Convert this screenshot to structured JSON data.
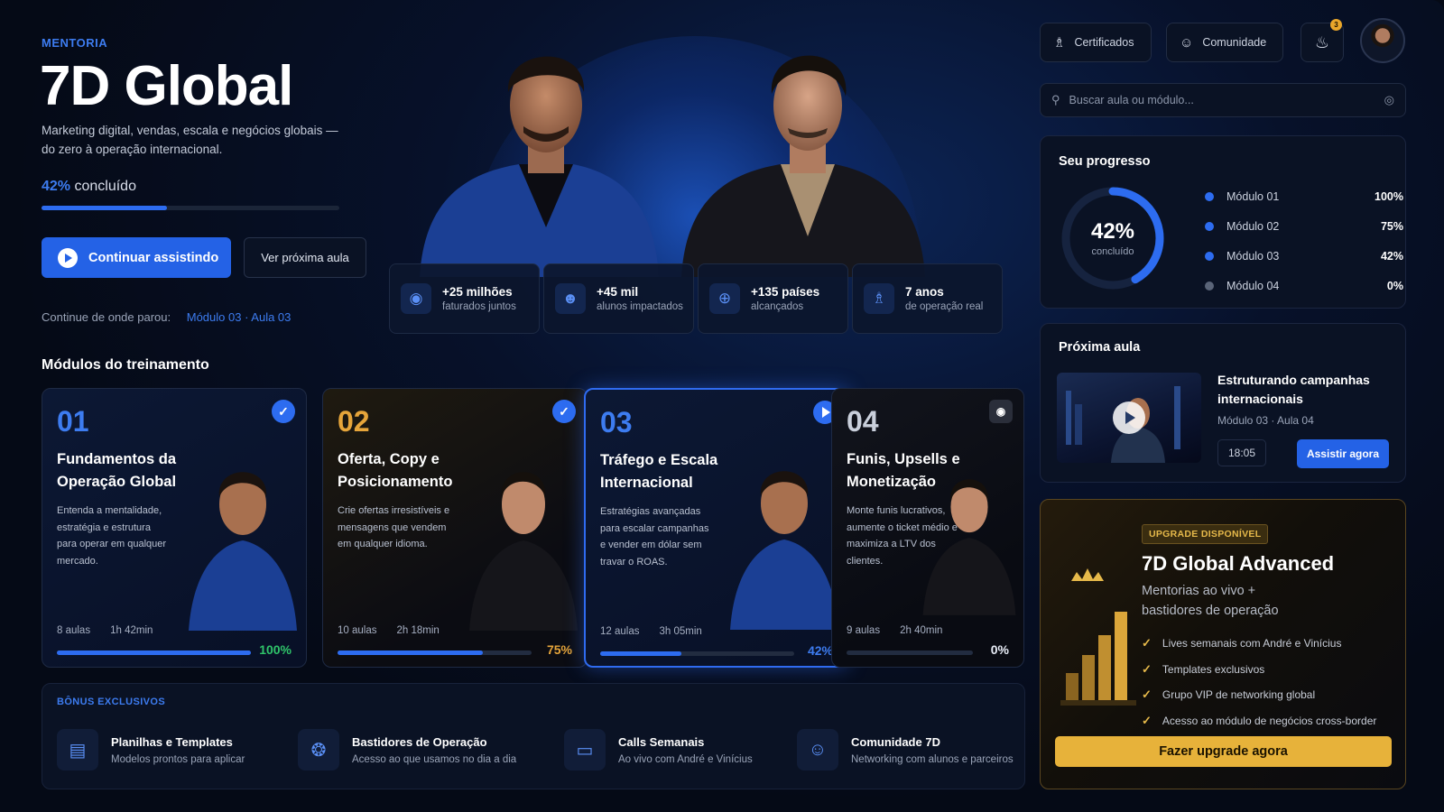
{
  "hero": {
    "kicker": "MENTORIA",
    "title": "7D Global",
    "tagline": "Marketing digital, vendas, escala e negócios globais — do zero à operação internacional.",
    "progress_pct_label": "42%",
    "progress_suffix": "concluído",
    "progress_value": 0.42,
    "primary_button": "Continuar assistindo",
    "secondary_button": "Ver próxima aula",
    "resume_label": "Continue de onde parou:",
    "resume_link": "Módulo 03 · Aula 03"
  },
  "stats": [
    {
      "value": "+25 milhões",
      "label": "faturados juntos",
      "icon": "money-icon"
    },
    {
      "value": "+45 mil",
      "label": "alunos impactados",
      "icon": "users-icon"
    },
    {
      "value": "+135 países",
      "label": "alcançados",
      "icon": "globe-icon"
    },
    {
      "value": "7 anos",
      "label": "de operação real",
      "icon": "trophy-icon"
    }
  ],
  "modules_section_title": "Módulos do treinamento",
  "modules": [
    {
      "num": "01",
      "title": "Fundamentos da Operação Global",
      "desc": "Entenda a mentalidade, estratégia e estrutura para operar em qualquer mercado.",
      "lessons": "8 aulas",
      "duration": "1h 42min",
      "pct": "100%",
      "progress": 1.0,
      "status": "completed",
      "num_color": "#3d7cf0",
      "pct_color": "#2fc46a"
    },
    {
      "num": "02",
      "title": "Oferta, Copy e Posicionamento",
      "desc": "Crie ofertas irresistíveis e mensagens que vendem em qualquer idioma.",
      "lessons": "10 aulas",
      "duration": "2h 18min",
      "pct": "75%",
      "progress": 0.75,
      "status": "completed",
      "num_color": "#e6a53a",
      "pct_color": "#e6a53a"
    },
    {
      "num": "03",
      "title": "Tráfego e Escala Internacional",
      "desc": "Estratégias avançadas para escalar campanhas e vender em dólar sem travar o ROAS.",
      "lessons": "12 aulas",
      "duration": "3h 05min",
      "pct": "42%",
      "progress": 0.42,
      "status": "in-progress",
      "num_color": "#3d7cf0",
      "pct_color": "#3d7cf0"
    },
    {
      "num": "04",
      "title": "Funis, Upsells e Monetização",
      "desc": "Monte funis lucrativos, aumente o ticket médio e maximiza a LTV dos clientes.",
      "lessons": "9 aulas",
      "duration": "2h 40min",
      "pct": "0%",
      "progress": 0.0,
      "status": "locked",
      "num_color": "#c9cfdb",
      "pct_color": "#e8edf7"
    }
  ],
  "bonus": {
    "title": "BÔNUS EXCLUSIVOS",
    "items": [
      {
        "title": "Planilhas e Templates",
        "sub": "Modelos prontos para aplicar",
        "icon": "document-icon"
      },
      {
        "title": "Bastidores de Operação",
        "sub": "Acesso ao que usamos no dia a dia",
        "icon": "compass-icon"
      },
      {
        "title": "Calls Semanais",
        "sub": "Ao vivo com André e Vinícius",
        "icon": "monitor-icon"
      },
      {
        "title": "Comunidade 7D",
        "sub": "Networking com alunos e parceiros",
        "icon": "community-icon"
      }
    ]
  },
  "topbar": {
    "certificates": "Certificados",
    "community": "Comunidade",
    "notifications": "3",
    "search_placeholder": "Buscar aula ou módulo..."
  },
  "progress_panel": {
    "title": "Seu progresso",
    "ring_pct": "42%",
    "ring_label": "concluído",
    "ring_value": 0.42,
    "items": [
      {
        "label": "Módulo 01",
        "value": "100%",
        "color": "#2d6cf0"
      },
      {
        "label": "Módulo 02",
        "value": "75%",
        "color": "#2d6cf0"
      },
      {
        "label": "Módulo 03",
        "value": "42%",
        "color": "#2d6cf0"
      },
      {
        "label": "Módulo 04",
        "value": "0%",
        "color": "#5a6478"
      }
    ]
  },
  "next_lesson": {
    "title": "Próxima aula",
    "lesson_title": "Estruturando campanhas internacionais",
    "lesson_sub": "Módulo 03 · Aula 04",
    "duration": "18:05",
    "button": "Assistir agora"
  },
  "upgrade": {
    "tag": "UPGRADE DISPONÍVEL",
    "title": "7D Global Advanced",
    "subtitle": "Mentorias ao vivo + bastidores de operação",
    "features": [
      "Lives semanais com André e Vinícius",
      "Templates exclusivos",
      "Grupo VIP de networking global",
      "Acesso ao módulo de negócios cross-border"
    ],
    "button": "Fazer upgrade agora"
  },
  "colors": {
    "accent": "#2462e6",
    "gold": "#e7b23a",
    "success": "#2fc46a"
  }
}
